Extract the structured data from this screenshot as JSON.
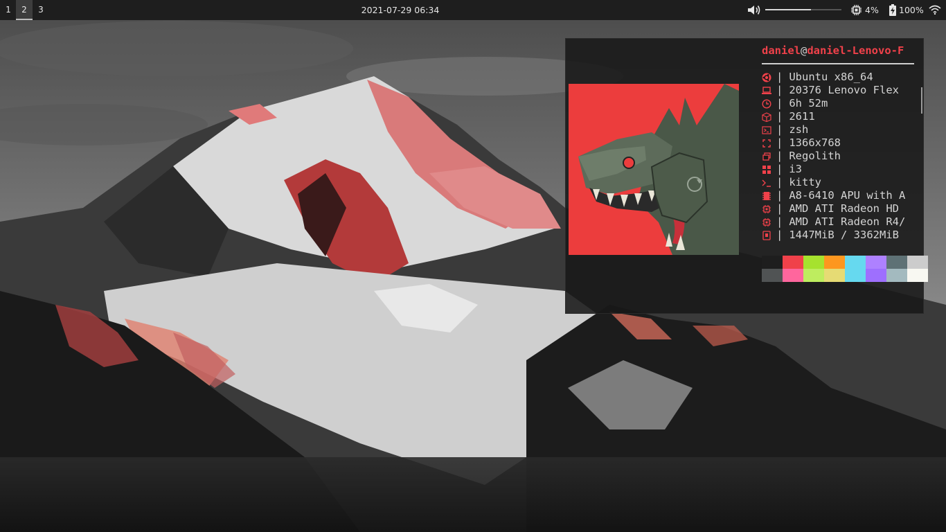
{
  "topbar": {
    "workspaces": [
      {
        "label": "1",
        "active": false
      },
      {
        "label": "2",
        "active": true
      },
      {
        "label": "3",
        "active": false
      }
    ],
    "clock": "2021-07-29 06:34",
    "volume_level": 0.6,
    "cpu": "4%",
    "battery": "100%"
  },
  "terminal": {
    "user": "daniel",
    "at": "@",
    "host": "daniel-Lenovo-F",
    "info": [
      {
        "icon": "ubuntu-icon",
        "value": "Ubuntu x86_64"
      },
      {
        "icon": "laptop-icon",
        "value": "20376 Lenovo Flex"
      },
      {
        "icon": "clock-icon",
        "value": "6h 52m"
      },
      {
        "icon": "package-icon",
        "value": "2611"
      },
      {
        "icon": "terminal-icon",
        "value": "zsh"
      },
      {
        "icon": "resolution-icon",
        "value": "1366x768"
      },
      {
        "icon": "windows-icon",
        "value": "Regolith"
      },
      {
        "icon": "grid-icon",
        "value": "i3"
      },
      {
        "icon": "prompt-icon",
        "value": "kitty"
      },
      {
        "icon": "cpu-chip-icon",
        "value": "A8-6410 APU with A"
      },
      {
        "icon": "gpu-icon",
        "value": "AMD ATI Radeon HD"
      },
      {
        "icon": "gpu-icon",
        "value": "AMD ATI Radeon R4/"
      },
      {
        "icon": "memory-icon",
        "value": "1447MiB / 3362MiB"
      }
    ],
    "separator": "|",
    "palette_top": [
      "#1e1e1e",
      "#f0414a",
      "#a6e22e",
      "#fd971f",
      "#66d9ef",
      "#ae81ff",
      "#5e7175",
      "#cccccc"
    ],
    "palette_bottom": [
      "#505354",
      "#ff669d",
      "#beed5f",
      "#e6db74",
      "#66d9ef",
      "#9e6ffe",
      "#a3babf",
      "#f8f8f2"
    ]
  },
  "colors": {
    "accent_red": "#f0414a",
    "bar_bg": "#1e1e1e",
    "terminal_bg": "#181818"
  }
}
